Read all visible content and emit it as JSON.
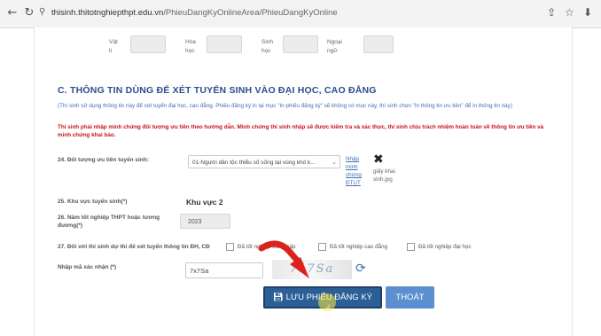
{
  "browser": {
    "url_domain": "thisinh.thitotnghiepthpt.edu.vn",
    "url_path": "/PhieuDangKyOnlineArea/PhieuDangKyOnline"
  },
  "subjects_row": [
    {
      "label": "Vật\nlí"
    },
    {
      "label": "Hóa\nhọc"
    },
    {
      "label": "Sinh\nhọc"
    },
    {
      "label": "Ngoại\nngữ"
    }
  ],
  "section_c": {
    "title": "C. THÔNG TIN DÙNG ĐỂ XÉT TUYỂN SINH VÀO ĐẠI HỌC, CAO ĐẲNG",
    "note_blue": "(Thí sinh sử dụng thông tin này để xét tuyển đại học, cao đẳng. Phiếu đăng ký in lại mục \"In phiếu đăng ký\" sẽ không có mục này, thí sinh chọn \"In thông tin ưu tiên\" để in thông tin này)",
    "note_red": "Thí sinh phải nhập minh chứng đối tượng ưu tiên theo hướng dẫn. Minh chứng thí sinh nhập sẽ được kiểm tra và xác thực, thí sinh chịu trách nhiệm hoàn toàn về thông tin ưu tiên và minh chứng khai báo."
  },
  "field_24": {
    "label": "24. Đối tượng ưu tiên tuyển sinh:",
    "selected": "01-Người dân tộc thiểu số sống tại vùng khó k...",
    "link": "Nhập minh chứng ĐTUT",
    "file_name": "giấy khai sinh.jpg"
  },
  "field_25": {
    "label": "25. Khu vực tuyển sinh(*)",
    "value": "Khu vực 2"
  },
  "field_26": {
    "label": "26. Năm tốt nghiệp THPT hoặc tương đương(*)",
    "value": "2023"
  },
  "field_27": {
    "label": "27. Đối với thí sinh dự thi để xét tuyển thông tin ĐH, CĐ",
    "options": [
      "Đã tốt nghiệp trung cấp",
      "Đã tốt nghiệp cao đẳng",
      "Đã tốt nghiệp đại học"
    ]
  },
  "captcha": {
    "label": "Nhập mã xác nhận (*)",
    "value": "7x7Sa",
    "image_text": "7x7Sa"
  },
  "buttons": {
    "save": "LƯU PHIẾU ĐĂNG KÝ",
    "exit": "THOÁT"
  },
  "colors": {
    "accent": "#2b5f95",
    "title": "#2b4e8c",
    "warning": "#c4161c",
    "note": "#3f6fb5"
  }
}
